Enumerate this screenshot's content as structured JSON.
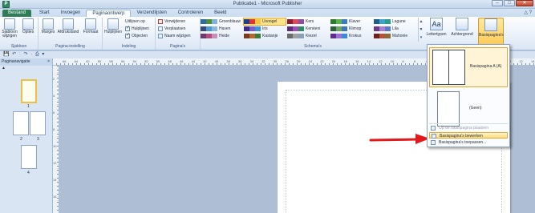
{
  "window": {
    "title": "Publicatie1 - Microsoft Publisher",
    "app_icon": "publisher-icon",
    "controls": [
      "–",
      "□",
      "✕"
    ]
  },
  "ribbon_tabs": [
    {
      "label": "Bestand"
    },
    {
      "label": "Start"
    },
    {
      "label": "Invoegen"
    },
    {
      "label": "Paginaontwerp"
    },
    {
      "label": "Verzendlijsten"
    },
    {
      "label": "Controleren"
    },
    {
      "label": "Beeld"
    }
  ],
  "help_icons": "△ ?",
  "groups": {
    "sjabloon": {
      "label": "Sjabloon",
      "buttons": [
        "Sjabloon wijzigen",
        "Opties"
      ]
    },
    "paginainstelling": {
      "label": "Pagina-instelling",
      "buttons": [
        "Marges",
        "Afdrukstand",
        "Formaat"
      ]
    },
    "indeling": {
      "label": "Indeling",
      "hulplijnen": "Hulplijnen",
      "items": [
        {
          "label": "Uitlijnen op",
          "type": "label"
        },
        {
          "label": "Hulplijnen",
          "type": "check",
          "checked": true
        },
        {
          "label": "Objecten",
          "type": "check",
          "checked": true
        }
      ]
    },
    "paginas": {
      "label": "Pagina's",
      "items": [
        "Verwijderen",
        "Verplaatsen",
        "Naam wijzigen"
      ]
    },
    "schemas": {
      "label": "Schema's",
      "items": [
        {
          "name": "Groenblauw",
          "colors": [
            "#2e6da4",
            "#4f8f3a",
            "#7fb3d8"
          ]
        },
        {
          "name": "Haven",
          "colors": [
            "#3a4a7a",
            "#4f9ad1",
            "#8ab8dd"
          ]
        },
        {
          "name": "Heide",
          "colors": [
            "#6b3a6e",
            "#b04f7f",
            "#c88fb5"
          ]
        },
        {
          "name": "Uvoogel",
          "colors": [
            "#1e3f8a",
            "#e3342f",
            "#f4c542"
          ],
          "active": true
        },
        {
          "name": "Iris",
          "colors": [
            "#3c2c8a",
            "#7b5fc9",
            "#3c98d8"
          ]
        },
        {
          "name": "Kastanje",
          "colors": [
            "#7a3a1f",
            "#b06a2f",
            "#3d7a3a"
          ]
        },
        {
          "name": "Kers",
          "colors": [
            "#8a1f2f",
            "#d94a5e",
            "#8a4fa0"
          ]
        },
        {
          "name": "Kersteni",
          "colors": [
            "#5a2f7a",
            "#9b4fb0",
            "#2e8a6b"
          ]
        },
        {
          "name": "Kiezel",
          "colors": [
            "#6a6a6a",
            "#a0a0a0",
            "#8aa0b8"
          ]
        },
        {
          "name": "Klaver",
          "colors": [
            "#2e7a2f",
            "#5fb04a",
            "#3b7ac9"
          ]
        },
        {
          "name": "Klimop",
          "colors": [
            "#2f5e3a",
            "#6ba35f",
            "#3c78b5"
          ]
        },
        {
          "name": "Krokus",
          "colors": [
            "#5b2f8a",
            "#9c6fd0",
            "#3e8ad8"
          ]
        },
        {
          "name": "Lagune",
          "colors": [
            "#1f5e8a",
            "#3fa3c9",
            "#2e9a8a"
          ]
        },
        {
          "name": "Lila",
          "colors": [
            "#6a3a8a",
            "#a87fd0",
            "#5a7ac9"
          ]
        },
        {
          "name": "Mahonie",
          "colors": [
            "#6e1f1f",
            "#b0553a",
            "#8a6a3a"
          ]
        }
      ],
      "scroll": [
        "▲",
        "▼",
        "▾"
      ]
    },
    "lettertypen": "Lettertypen",
    "achtergrond": "Achtergrond",
    "basispagina": "Basispagina's"
  },
  "qat": "💾 ↶ · ↷ · ⎙ ▾",
  "nav": {
    "title": "Paginanavigatie",
    "close": "×",
    "section": "▲",
    "pages": [
      "1",
      "2",
      "3",
      "4"
    ]
  },
  "ruler_numbers": [
    "66",
    "64",
    "62",
    "60",
    "58",
    "56",
    "54",
    "52",
    "50",
    "48",
    "46",
    "44",
    "42",
    "40",
    "38",
    "36",
    "34",
    "32",
    "30",
    "28",
    "26",
    "24",
    "22",
    "20",
    "18",
    "16",
    "14",
    "12",
    "10",
    "8",
    "6",
    "4",
    "2",
    "0",
    "2",
    "4",
    "6",
    "8",
    "10",
    "12",
    "14"
  ],
  "vruler_numbers": [
    "2",
    "4",
    "6",
    "8",
    "10",
    "12",
    "14",
    "16"
  ],
  "dropdown": {
    "options": [
      {
        "label": "Basispagina A (A)",
        "selected": true
      },
      {
        "label": "(Geen)",
        "selected": false
      }
    ],
    "commands": [
      {
        "label": "Op de basispagina plaatsen",
        "disabled": true
      },
      {
        "label": "Basispagina's bewerken",
        "hover": true
      },
      {
        "label": "Basispagina's toepassen...",
        "disabled": false
      }
    ]
  },
  "annotation": {
    "color": "#e0191d"
  }
}
